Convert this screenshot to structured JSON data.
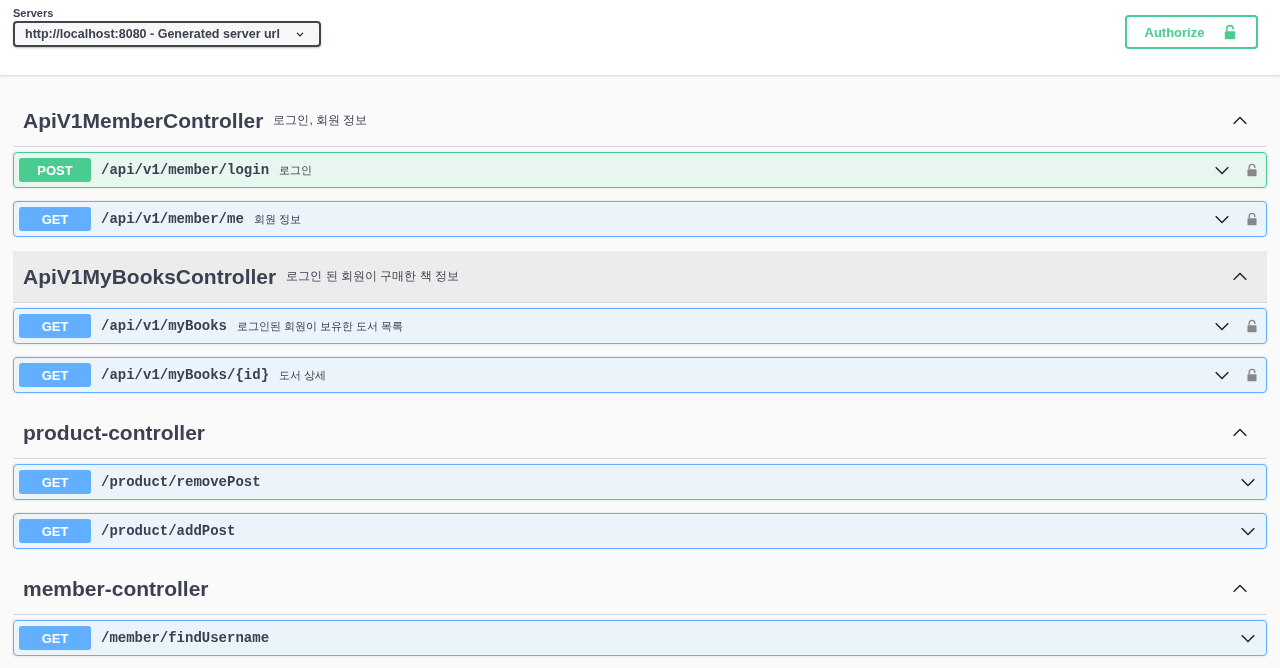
{
  "servers": {
    "label": "Servers",
    "value": "http://localhost:8080 - Generated server url"
  },
  "authorize": {
    "label": "Authorize"
  },
  "sections": [
    {
      "title": "ApiV1MemberController",
      "description": "로그인, 회원 정보",
      "expanded": true,
      "hovered": false,
      "operations": [
        {
          "method": "POST",
          "path": "/api/v1/member/login",
          "summary": "로그인",
          "secured": true
        },
        {
          "method": "GET",
          "path": "/api/v1/member/me",
          "summary": "회원 정보",
          "secured": true
        }
      ]
    },
    {
      "title": "ApiV1MyBooksController",
      "description": "로그인 된 회원이 구매한 책 정보",
      "expanded": true,
      "hovered": true,
      "operations": [
        {
          "method": "GET",
          "path": "/api/v1/myBooks",
          "summary": "로그인된 회원이 보유한 도서 목록",
          "secured": true
        },
        {
          "method": "GET",
          "path": "/api/v1/myBooks/{id}",
          "summary": "도서 상세",
          "secured": true
        }
      ]
    },
    {
      "title": "product-controller",
      "expanded": true,
      "hovered": false,
      "operations": [
        {
          "method": "GET",
          "path": "/product/removePost",
          "secured": false
        },
        {
          "method": "GET",
          "path": "/product/addPost",
          "secured": false
        }
      ]
    },
    {
      "title": "member-controller",
      "expanded": true,
      "hovered": false,
      "operations": [
        {
          "method": "GET",
          "path": "/member/findUsername",
          "secured": false
        }
      ]
    }
  ]
}
